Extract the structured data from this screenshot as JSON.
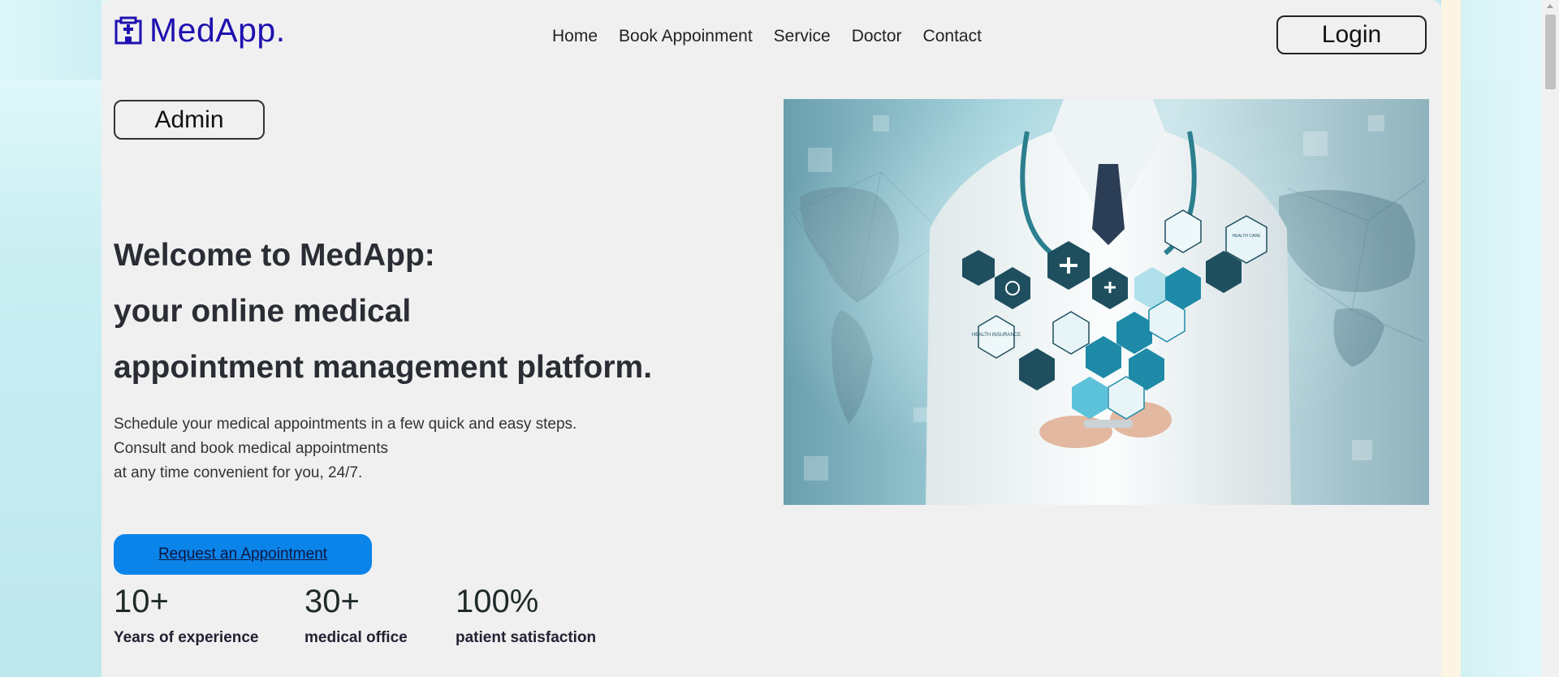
{
  "header": {
    "brand": "MedApp.",
    "nav": [
      "Home",
      "Book Appoinment",
      "Service",
      "Doctor",
      "Contact"
    ],
    "login_label": "Login"
  },
  "admin_label": "Admin",
  "hero": {
    "title_lines": [
      "Welcome to MedApp:",
      "your online medical",
      "appointment management platform."
    ],
    "description_lines": [
      "Schedule your medical appointments in a few quick and easy steps.",
      "Consult and book medical appointments",
      "at any time convenient for you, 24/7."
    ],
    "cta_label": "Request an Appointment"
  },
  "stats": [
    {
      "value": "10+",
      "label": "Years of experience"
    },
    {
      "value": "30+",
      "label": "medical office"
    },
    {
      "value": "100%",
      "label": "patient satisfaction"
    }
  ],
  "image_text": {
    "health_insurance": "HEALTH INSURANCE",
    "health_care": "HEALTH CARE"
  },
  "colors": {
    "brand": "#1f11b0",
    "cta": "#0b84ea",
    "panel": "#f0f0f0"
  }
}
